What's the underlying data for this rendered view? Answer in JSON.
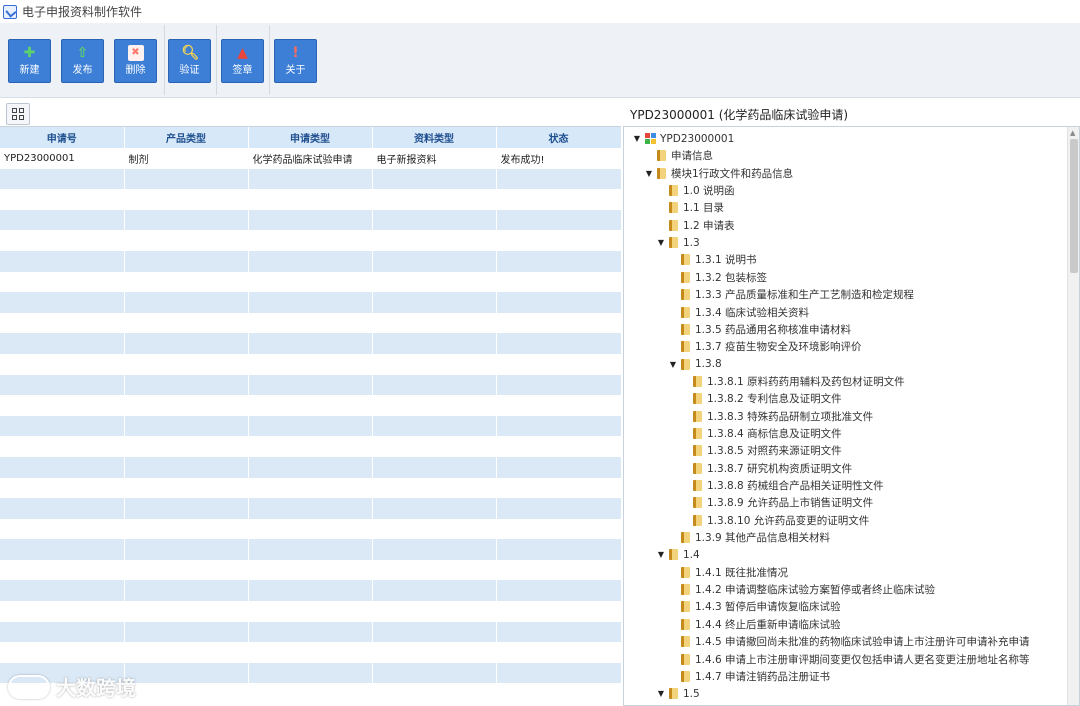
{
  "window": {
    "title": "电子申报资料制作软件"
  },
  "toolbar": {
    "buttons": [
      {
        "id": "new",
        "label": "新建",
        "icon": "plus-icon",
        "color": "#3cb44a"
      },
      {
        "id": "publish",
        "label": "发布",
        "icon": "upload-icon",
        "color": "#3cb44a"
      },
      {
        "id": "delete",
        "label": "删除",
        "icon": "delete-icon",
        "color": "#e34b3c"
      },
      {
        "id": "verify",
        "label": "验证",
        "icon": "magnifier-icon",
        "color": "#f2c230"
      },
      {
        "id": "sign",
        "label": "签章",
        "icon": "stamp-icon",
        "color": "#d13b2f"
      },
      {
        "id": "about",
        "label": "关于",
        "icon": "info-icon",
        "color": "#e34b3c"
      }
    ]
  },
  "table": {
    "columns": [
      "申请号",
      "产品类型",
      "申请类型",
      "资料类型",
      "状态"
    ],
    "rows": [
      [
        "YPD23000001",
        "制剂",
        "化学药品临床试验申请",
        "电子新报资料",
        "发布成功!"
      ]
    ]
  },
  "tree": {
    "title": "YPD23000001 (化学药品临床试验申请)",
    "nodes": [
      {
        "label": "YPD23000001",
        "level": 0,
        "expanded": true,
        "root": true
      },
      {
        "label": "申请信息",
        "level": 1
      },
      {
        "label": "模块1行政文件和药品信息",
        "level": 1,
        "expanded": true
      },
      {
        "label": "1.0 说明函",
        "level": 2
      },
      {
        "label": "1.1 目录",
        "level": 2
      },
      {
        "label": "1.2 申请表",
        "level": 2
      },
      {
        "label": "1.3",
        "level": 2,
        "expanded": true
      },
      {
        "label": "1.3.1 说明书",
        "level": 3
      },
      {
        "label": "1.3.2 包装标签",
        "level": 3
      },
      {
        "label": "1.3.3 产品质量标准和生产工艺制造和检定规程",
        "level": 3
      },
      {
        "label": "1.3.4 临床试验相关资料",
        "level": 3
      },
      {
        "label": "1.3.5 药品通用名称核准申请材料",
        "level": 3
      },
      {
        "label": "1.3.7 疫苗生物安全及环境影响评价",
        "level": 3
      },
      {
        "label": "1.3.8",
        "level": 3,
        "expanded": true
      },
      {
        "label": "1.3.8.1 原料药药用辅料及药包材证明文件",
        "level": 4
      },
      {
        "label": "1.3.8.2 专利信息及证明文件",
        "level": 4
      },
      {
        "label": "1.3.8.3 特殊药品研制立项批准文件",
        "level": 4
      },
      {
        "label": "1.3.8.4 商标信息及证明文件",
        "level": 4
      },
      {
        "label": "1.3.8.5 对照药来源证明文件",
        "level": 4
      },
      {
        "label": "1.3.8.7 研究机构资质证明文件",
        "level": 4
      },
      {
        "label": "1.3.8.8 药械组合产品相关证明性文件",
        "level": 4
      },
      {
        "label": "1.3.8.9 允许药品上市销售证明文件",
        "level": 4
      },
      {
        "label": "1.3.8.10 允许药品变更的证明文件",
        "level": 4
      },
      {
        "label": "1.3.9 其他产品信息相关材料",
        "level": 3
      },
      {
        "label": "1.4",
        "level": 2,
        "expanded": true
      },
      {
        "label": "1.4.1 既往批准情况",
        "level": 3
      },
      {
        "label": "1.4.2 申请调整临床试验方案暂停或者终止临床试验",
        "level": 3
      },
      {
        "label": "1.4.3 暂停后申请恢复临床试验",
        "level": 3
      },
      {
        "label": "1.4.4 终止后重新申请临床试验",
        "level": 3
      },
      {
        "label": "1.4.5 申请撤回尚未批准的药物临床试验申请上市注册许可申请补充申请",
        "level": 3
      },
      {
        "label": "1.4.6 申请上市注册审评期间变更仅包括申请人更名变更注册地址名称等",
        "level": 3
      },
      {
        "label": "1.4.7 申请注销药品注册证书",
        "level": 3
      },
      {
        "label": "1.5",
        "level": 2,
        "expanded": true
      }
    ]
  },
  "watermark": {
    "text": "大数跨境"
  }
}
